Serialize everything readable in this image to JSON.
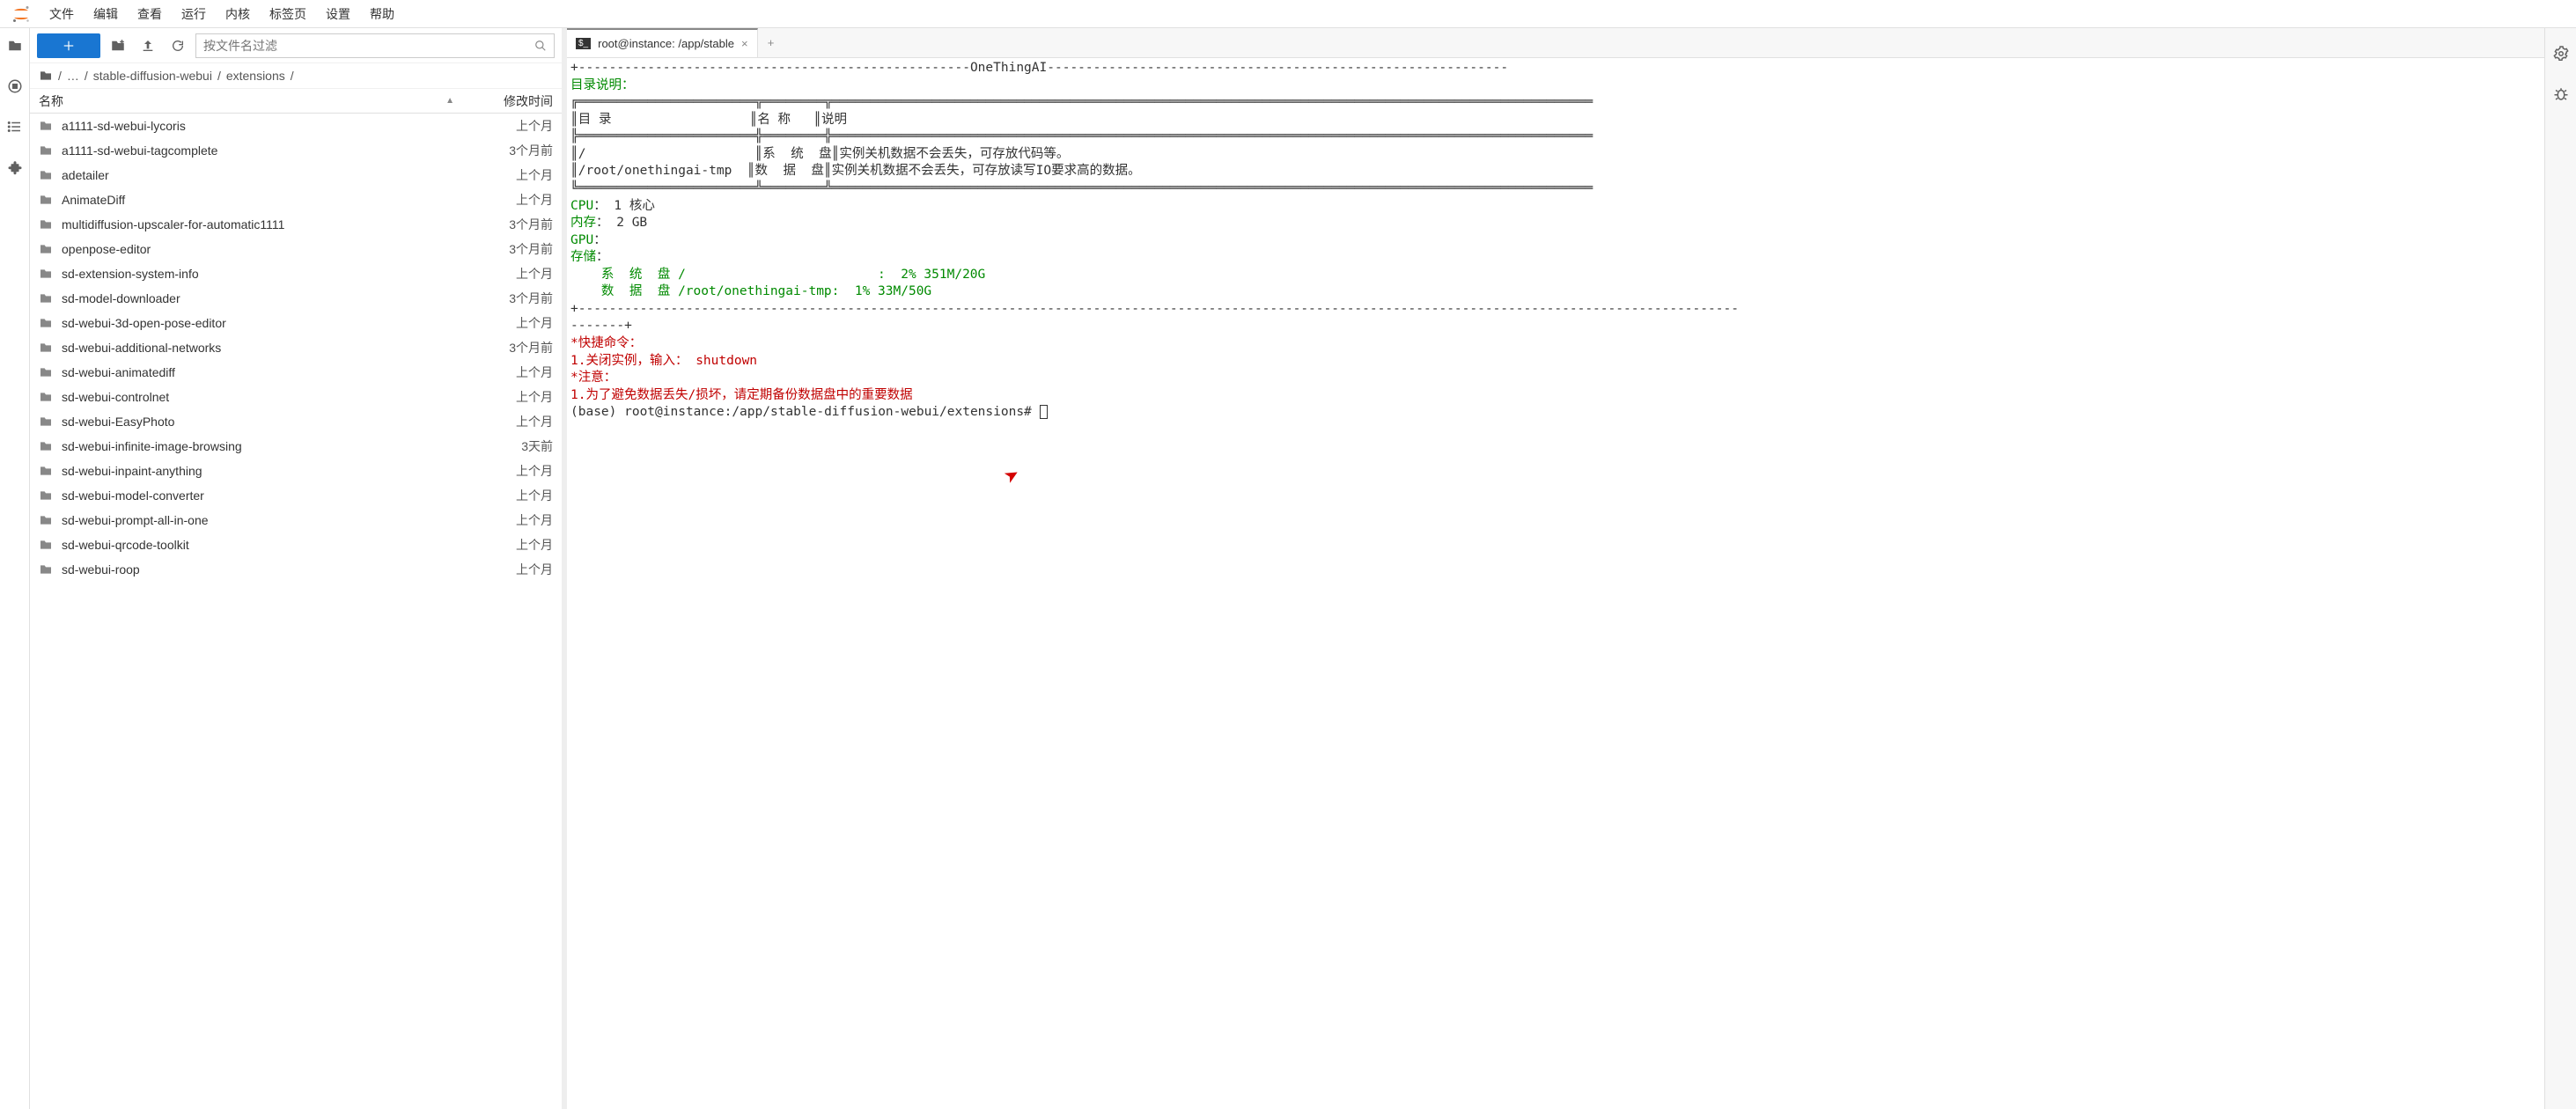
{
  "menubar": [
    "文件",
    "编辑",
    "查看",
    "运行",
    "内核",
    "标签页",
    "设置",
    "帮助"
  ],
  "file_toolbar": {
    "filter_placeholder": "按文件名过滤"
  },
  "breadcrumb": {
    "segments": [
      "/",
      "…",
      "/",
      "stable-diffusion-webui",
      "/",
      "extensions",
      "/"
    ]
  },
  "columns": {
    "name": "名称",
    "mtime": "修改时间"
  },
  "files": [
    {
      "name": "a1111-sd-webui-lycoris",
      "mtime": "上个月"
    },
    {
      "name": "a1111-sd-webui-tagcomplete",
      "mtime": "3个月前"
    },
    {
      "name": "adetailer",
      "mtime": "上个月"
    },
    {
      "name": "AnimateDiff",
      "mtime": "上个月"
    },
    {
      "name": "multidiffusion-upscaler-for-automatic1111",
      "mtime": "3个月前"
    },
    {
      "name": "openpose-editor",
      "mtime": "3个月前"
    },
    {
      "name": "sd-extension-system-info",
      "mtime": "上个月"
    },
    {
      "name": "sd-model-downloader",
      "mtime": "3个月前"
    },
    {
      "name": "sd-webui-3d-open-pose-editor",
      "mtime": "上个月"
    },
    {
      "name": "sd-webui-additional-networks",
      "mtime": "3个月前"
    },
    {
      "name": "sd-webui-animatediff",
      "mtime": "上个月"
    },
    {
      "name": "sd-webui-controlnet",
      "mtime": "上个月"
    },
    {
      "name": "sd-webui-EasyPhoto",
      "mtime": "上个月"
    },
    {
      "name": "sd-webui-infinite-image-browsing",
      "mtime": "3天前"
    },
    {
      "name": "sd-webui-inpaint-anything",
      "mtime": "上个月"
    },
    {
      "name": "sd-webui-model-converter",
      "mtime": "上个月"
    },
    {
      "name": "sd-webui-prompt-all-in-one",
      "mtime": "上个月"
    },
    {
      "name": "sd-webui-qrcode-toolkit",
      "mtime": "上个月"
    },
    {
      "name": "sd-webui-roop",
      "mtime": "上个月"
    }
  ],
  "tab": {
    "title": "root@instance: /app/stable"
  },
  "terminal": {
    "banner_dash_prefix": "+---------------------------------------------------",
    "banner_title": "OneThingAI",
    "banner_dash_suffix": "------------------------------------------------------------",
    "dir_heading": "目录说明：",
    "tbl_top": "╔═══════════════════════╦════════╦═══════════════════════════════════════════════════════════════════════════════════════════════════",
    "tbl_hdr": "║目 录                  ║名 称   ║说明",
    "tbl_sep": "╠═══════════════════════╬════════╬═══════════════════════════════════════════════════════════════════════════════════════════════════",
    "tbl_row1": "║/                      ║系  统  盘║实例关机数据不会丢失，可存放代码等。",
    "tbl_row2": "║/root/onethingai-tmp  ║数  据  盘║实例关机数据不会丢失，可存放读写IO要求高的数据。",
    "tbl_bot": "╚═══════════════════════╩════════╩═══════════════════════════════════════════════════════════════════════════════════════════════════",
    "cpu_label": "CPU",
    "cpu_value": "： 1 核心",
    "mem_label": "内存",
    "mem_value": "： 2 GB",
    "gpu_label": "GPU",
    "gpu_value": "：",
    "storage_label": "存储",
    "storage_value": "：",
    "disk_sys": "    系  统  盘 /                         :  2% 351M/20G",
    "disk_data": "    数  据  盘 /root/onethingai-tmp:  1% 33M/50G",
    "dash_line": "+-------------------------------------------------------------------------------------------------------------------------------------------------------",
    "dash_line2": "-------+",
    "cmd_heading": "*快捷命令：",
    "cmd_line1": "1.关闭实例，输入： shutdown",
    "note_heading": "*注意：",
    "note_line1": "1.为了避免数据丢失/损坏，请定期备份数据盘中的重要数据",
    "prompt": "(base) root@instance:/app/stable-diffusion-webui/extensions# "
  }
}
